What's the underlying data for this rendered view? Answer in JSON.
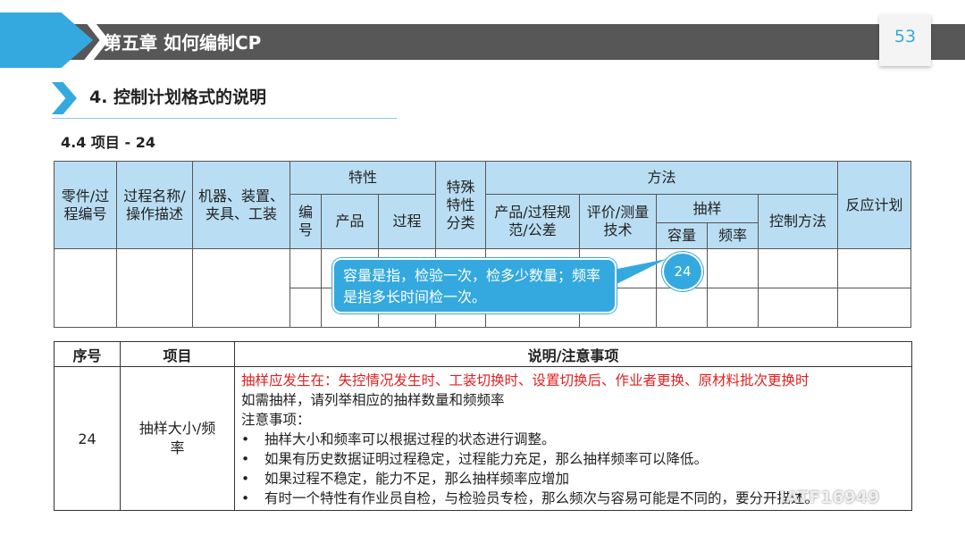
{
  "header": {
    "chapter": "第五章  如何编制CP",
    "page_number": "53"
  },
  "section": {
    "title": "4. 控制计划格式的说明",
    "subtitle": "4.4 项目 - 24"
  },
  "form": {
    "h_part": "零件/过程编号",
    "h_process": "过程名称/操作描述",
    "h_machine": "机器、装置、夹具、工装",
    "h_char": "特性",
    "h_char_no": "编号",
    "h_char_product": "产品",
    "h_char_process": "过程",
    "h_special": "特殊特性分类",
    "h_method": "方法",
    "h_spec": "产品/过程规范/公差",
    "h_eval": "评价/测量技术",
    "h_sample": "抽样",
    "h_size": "容量",
    "h_freq": "频率",
    "h_control": "控制方法",
    "h_reaction": "反应计划"
  },
  "callout": {
    "text": "容量是指，检验一次，检多少数量；频率是指多长时间检一次。",
    "marker": "24"
  },
  "table": {
    "headers": {
      "no": "序号",
      "item": "项目",
      "desc": "说明/注意事项"
    },
    "row": {
      "no": "24",
      "item": "抽样大小/频率",
      "line_red": "抽样应发生在：失控情况发生时、工装切换时、设置切换后、作业者更换、原材料批次更换时",
      "line2": "如需抽样，请列举相应的抽样数量和频频率",
      "line3": "注意事项：",
      "bullets": [
        "抽样大小和频率可以根据过程的状态进行调整。",
        "如果有历史数据证明过程稳定，过程能力充足，那么抽样频率可以降低。",
        "如果过程不稳定，能力不足，那么抽样频率应增加",
        "有时一个特性有作业员自检，与检验员专检，那么频次与容易可能是不同的，要分开描述。"
      ]
    }
  },
  "watermark": "IATF16949",
  "colors": {
    "accent": "#34a9df",
    "header_grey": "#575757",
    "header_fill": "#b9def3",
    "alert": "#e02020"
  }
}
